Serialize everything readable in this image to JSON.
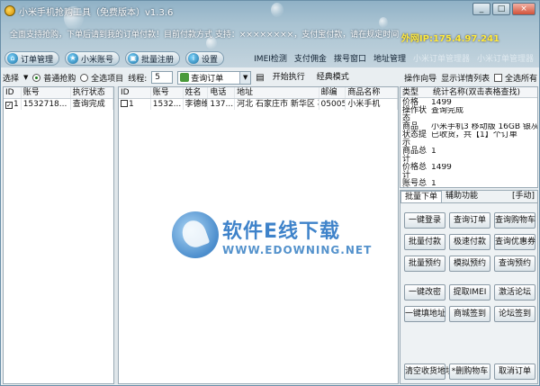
{
  "window": {
    "title": "小米手机抢购工具（免费版本）v1.3.6",
    "min_label": "_",
    "max_label": "□",
    "close_label": "×"
  },
  "header": {
    "notice": "全面支持抢购，下单后请到我的订单付款！目前付款方式 支持：××××××××，支付宝付款，请在规定时间",
    "ip_text": "外网IP:175.4.97.241",
    "nav": [
      {
        "icon": "home-icon",
        "glyph": "⌂",
        "label": "订单管理"
      },
      {
        "icon": "star-icon",
        "glyph": "★",
        "label": "小米账号"
      },
      {
        "icon": "window-icon",
        "glyph": "▣",
        "label": "批量注册"
      },
      {
        "icon": "info-icon",
        "glyph": "i",
        "label": "设置"
      }
    ],
    "right_links": [
      "IMEI检测",
      "支付佣金",
      "拨号窗口",
      "地址管理",
      "小米订单管理器",
      "小米订单管理器"
    ]
  },
  "toolbar": {
    "select_label": "选择",
    "radio1": "普通抢购",
    "radio2": "全选项目",
    "threads_label": "线程:",
    "threads_value": "5",
    "combo_value": "查询订单",
    "btn_retry": "开始执行",
    "btn_classic": "经典模式",
    "guide": "操作向导",
    "detail_list": "显示详情列表",
    "check_label": "全选所有"
  },
  "left_table": {
    "columns": [
      "ID",
      "账号",
      "执行状态"
    ],
    "rows": [
      [
        "1",
        "1532718...",
        "查询完成"
      ]
    ]
  },
  "main_table": {
    "columns": [
      "ID",
      "账号",
      "姓名",
      "电话",
      "地址",
      "",
      "邮编",
      "商品名称"
    ],
    "rows": [
      [
        "1",
        "1532...",
        "李德维",
        "137...",
        "河北 石家庄市 新华区 石家庄新...",
        "",
        "050051",
        "小米手机"
      ]
    ]
  },
  "info_panel": {
    "columns": [
      "类型",
      "统计名称(双击表格查找)"
    ],
    "items": [
      {
        "k": "价格",
        "v": "1499"
      },
      {
        "k": "操作状态",
        "v": "查询完成"
      },
      {
        "k": "商品",
        "v": "小米手机3 移动版 16GB 银灰色"
      },
      {
        "k": "状态提示",
        "v": "已收货，共【1】个订单"
      },
      {
        "k": "商品总计",
        "v": "1"
      },
      {
        "k": "价格总计",
        "v": "1499"
      },
      {
        "k": "账号总计",
        "v": "1"
      }
    ]
  },
  "func_panel": {
    "tabs": [
      "批量下单",
      "辅助功能"
    ],
    "manual": "[手动]",
    "buttons": [
      [
        "一键登录",
        "查询订单",
        "查询购物车"
      ],
      [
        "批量付款",
        "极速付款",
        "查询优惠券"
      ],
      [
        "批量预约",
        "模拟预约",
        "查询预约"
      ],
      [
        "一键改密",
        "提取IMEI",
        "激活论坛"
      ],
      [
        "一键填地址",
        "商城签到",
        "论坛签到"
      ],
      [
        "清空收货地址",
        "*删购物车",
        "取消订单"
      ]
    ]
  },
  "watermark": {
    "line1": "软件E线下载",
    "line2": "WWW.EDOWNING.NET"
  }
}
